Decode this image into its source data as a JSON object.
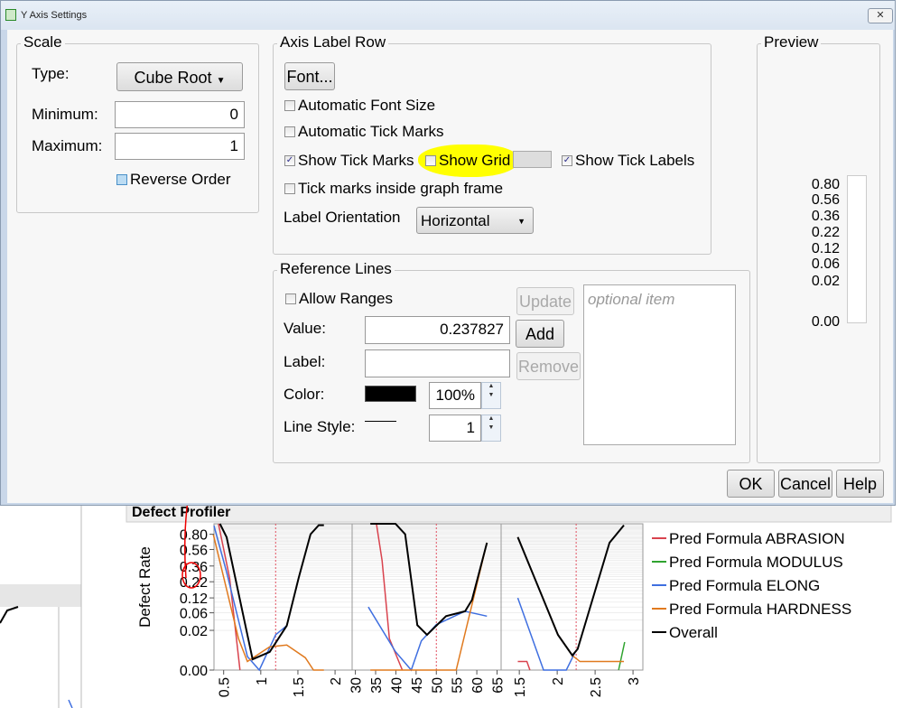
{
  "window": {
    "title": "Y Axis Settings",
    "close": "✕"
  },
  "scale": {
    "legend": "Scale",
    "type_label": "Type:",
    "type_value": "Cube Root",
    "min_label": "Minimum:",
    "min_value": "0",
    "max_label": "Maximum:",
    "max_value": "1",
    "reverse_order": "Reverse Order",
    "reverse_checked": false
  },
  "axis_label_row": {
    "legend": "Axis Label Row",
    "font_button": "Font...",
    "auto_font_size": "Automatic Font Size",
    "auto_tick_marks": "Automatic Tick Marks",
    "show_tick_marks": "Show Tick Marks",
    "show_grid": "Show Grid",
    "show_tick_labels": "Show Tick Labels",
    "tick_inside": "Tick marks inside graph frame",
    "label_orientation_label": "Label Orientation",
    "label_orientation_value": "Horizontal",
    "checked": {
      "auto_font_size": false,
      "auto_tick_marks": false,
      "show_tick_marks": true,
      "show_grid": false,
      "show_tick_labels": true,
      "tick_inside": false
    },
    "highlight_color": "#ffff00"
  },
  "reference_lines": {
    "legend": "Reference Lines",
    "allow_ranges": "Allow Ranges",
    "value_label": "Value:",
    "value": "0.237827",
    "label_label": "Label:",
    "label_value": "",
    "color_label": "Color:",
    "color": "#000000",
    "opacity": "100%",
    "line_style_label": "Line Style:",
    "line_width": "1",
    "update": "Update",
    "add": "Add",
    "remove": "Remove",
    "list_placeholder": "optional item"
  },
  "preview": {
    "legend": "Preview",
    "ticks": [
      "0.80",
      "0.56",
      "0.36",
      "0.22",
      "0.12",
      "0.06",
      "0.02",
      "0.00"
    ]
  },
  "buttons": {
    "ok": "OK",
    "cancel": "Cancel",
    "help": "Help"
  },
  "background": {
    "panel_title": "Defect Profiler"
  },
  "chart_data": {
    "type": "line",
    "ylabel": "Defect Rate",
    "yscale": "cube-root",
    "ylim": [
      0,
      1
    ],
    "yticks": [
      "0.80",
      "0.56",
      "0.36",
      "0.22",
      "0.12",
      "0.06",
      "0.02",
      "0.00"
    ],
    "panels": [
      {
        "xticks": [
          "0.5",
          "1",
          "1.5",
          "2"
        ],
        "xlim": [
          0.37,
          2.23
        ],
        "reference_x": 1.2,
        "series": {
          "ABRASION": [
            [
              0.43,
              1
            ],
            [
              0.58,
              0.25
            ],
            [
              0.72,
              0
            ]
          ],
          "ELONG": [
            [
              0.37,
              0.96
            ],
            [
              0.54,
              0.3
            ],
            [
              0.82,
              0.0008
            ],
            [
              0.98,
              0
            ],
            [
              1.2,
              0.014
            ],
            [
              1.35,
              0.028
            ]
          ],
          "HARDNESS": [
            [
              0.36,
              0.8
            ],
            [
              0.7,
              0.01
            ],
            [
              0.82,
              0.0002
            ],
            [
              1.12,
              0.004
            ],
            [
              1.35,
              0.005
            ],
            [
              1.6,
              0.0006
            ],
            [
              1.71,
              0
            ],
            [
              1.85,
              0
            ]
          ],
          "Overall": [
            [
              0.45,
              1
            ],
            [
              0.54,
              0.75
            ],
            [
              0.89,
              0.0004
            ],
            [
              1.12,
              0.0019
            ],
            [
              1.35,
              0.028
            ],
            [
              1.51,
              0.25
            ],
            [
              1.67,
              0.8
            ],
            [
              1.78,
              0.97
            ],
            [
              1.85,
              0.97
            ]
          ]
        }
      },
      {
        "xticks": [
          "30",
          "35",
          "40",
          "45",
          "50",
          "55",
          "60",
          "65"
        ],
        "xlim": [
          29.2,
          66
        ],
        "reference_x": 50,
        "series": {
          "ABRASION": [
            [
              35.2,
              1
            ],
            [
              36.6,
              0.42
            ],
            [
              38.4,
              0.01
            ],
            [
              41.6,
              0
            ]
          ],
          "ELONG": [
            [
              33.2,
              0.08
            ],
            [
              39.9,
              0.002
            ],
            [
              43.8,
              0
            ],
            [
              46.3,
              0.008
            ],
            [
              50,
              0.03
            ],
            [
              57.1,
              0.065
            ],
            [
              62.5,
              0.05
            ]
          ],
          "HARDNESS": [
            [
              33.7,
              0
            ],
            [
              49.2,
              0
            ],
            [
              54.9,
              0
            ],
            [
              62.5,
              0.66
            ]
          ],
          "Overall": [
            [
              33.7,
              1
            ],
            [
              39.9,
              1
            ],
            [
              42.3,
              0.8
            ],
            [
              45.3,
              0.029
            ],
            [
              47.7,
              0.014
            ],
            [
              52.4,
              0.05
            ],
            [
              57.1,
              0.065
            ],
            [
              58.8,
              0.11
            ],
            [
              62.5,
              0.66
            ]
          ]
        }
      },
      {
        "xticks": [
          "1.5",
          "2",
          "2.5",
          "3"
        ],
        "xlim": [
          1.26,
          3.13
        ],
        "reference_x": 2.25,
        "series": {
          "ABRASION": [
            [
              1.48,
              0.0002
            ],
            [
              1.6,
              0.0002
            ],
            [
              1.64,
              0
            ]
          ],
          "MODULUS": [
            [
              2.81,
              0
            ],
            [
              2.89,
              0.007
            ]
          ],
          "ELONG": [
            [
              1.48,
              0.12
            ],
            [
              1.82,
              0
            ],
            [
              2.12,
              0
            ],
            [
              2.24,
              0.002
            ]
          ],
          "HARDNESS": [
            [
              1.48,
              0.75
            ],
            [
              2.01,
              0.014
            ],
            [
              2.2,
              0.001
            ],
            [
              2.3,
              0.0002
            ],
            [
              2.88,
              0.0002
            ]
          ],
          "Overall": [
            [
              1.48,
              0.75
            ],
            [
              2.01,
              0.014
            ],
            [
              2.2,
              0.001
            ],
            [
              2.27,
              0.003
            ],
            [
              2.69,
              0.66
            ],
            [
              2.88,
              0.97
            ]
          ]
        }
      }
    ],
    "legend": [
      {
        "name": "Pred Formula ABRASION",
        "color": "#d9434e"
      },
      {
        "name": "Pred Formula MODULUS",
        "color": "#2fa32f"
      },
      {
        "name": "Pred Formula ELONG",
        "color": "#3f6fe0"
      },
      {
        "name": "Pred Formula HARDNESS",
        "color": "#e07a1f"
      },
      {
        "name": "Overall",
        "color": "#000000"
      }
    ],
    "legend_placement": "right"
  }
}
